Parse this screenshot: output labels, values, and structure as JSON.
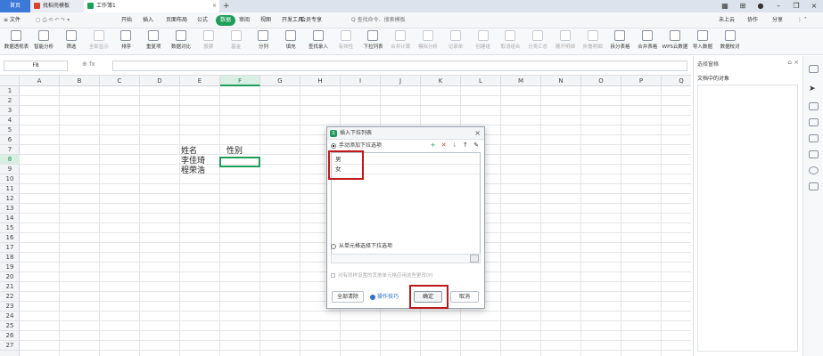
{
  "tabs": {
    "home": "首页",
    "template": "找稻壳模板",
    "workbook": "工作簿1",
    "new_tab": "+"
  },
  "menu": {
    "file": "≡ 文件",
    "items": [
      "开始",
      "插入",
      "页面布局",
      "公式",
      "数据",
      "审阅",
      "视图",
      "开发工具",
      "会员专享"
    ],
    "active_index": 4,
    "search": "Q 查找命令、搜索模板",
    "cloud": "未上云",
    "collab": "协作",
    "share": "分享"
  },
  "ribbon": {
    "buttons": [
      "数据透视表",
      "智能分析",
      "筛选",
      "全部显示",
      "排序",
      "重复项",
      "数据对比",
      "股票",
      "基金",
      "分列",
      "填充",
      "查找录入",
      "有效性",
      "下拉列表",
      "合并计算",
      "模拟分析",
      "记录单",
      "创建组",
      "取消组合",
      "分类汇总",
      "展开明细",
      "折叠明细",
      "拆分表格",
      "合并表格",
      "WPS云数据",
      "导入数据",
      "数据校对"
    ],
    "dim_indices": [
      3,
      7,
      8,
      12,
      14,
      15,
      16,
      17,
      18,
      19,
      20,
      21
    ]
  },
  "formula_bar": {
    "name_box": "F8",
    "fx": "⊕  fx"
  },
  "grid": {
    "columns": [
      "A",
      "B",
      "C",
      "D",
      "E",
      "F",
      "G",
      "H",
      "I",
      "J",
      "K",
      "L",
      "M",
      "N",
      "O",
      "P",
      "Q"
    ],
    "selected_column": "F",
    "rows": [
      "1",
      "2",
      "3",
      "4",
      "5",
      "6",
      "7",
      "8",
      "9",
      "10",
      "11",
      "12",
      "13",
      "14",
      "15",
      "16",
      "17",
      "18",
      "19",
      "20",
      "21",
      "22",
      "23",
      "24",
      "25",
      "26",
      "27"
    ],
    "selected_row": "8",
    "cells": {
      "E7": "姓名",
      "F7": "性别",
      "E8": "李佳琦",
      "E9": "程荣浩"
    }
  },
  "right_panel": {
    "title": "选择窗格",
    "subtitle": "文档中的对象",
    "controls": "⌂ ×"
  },
  "dialog": {
    "title": "插入下拉列表",
    "close": "×",
    "manual_option": "手动添加下拉选项",
    "list_tools": [
      "+",
      "✕",
      "↓",
      "↑",
      "✎"
    ],
    "items": [
      "男",
      "女"
    ],
    "from_cells_option": "从单元格选择下拉选项",
    "apply_same": "对有同样设置的其他单元格应用这些更改(P)",
    "clear_all": "全部清除",
    "tips": "操作技巧",
    "ok": "确定",
    "cancel": "取消"
  }
}
